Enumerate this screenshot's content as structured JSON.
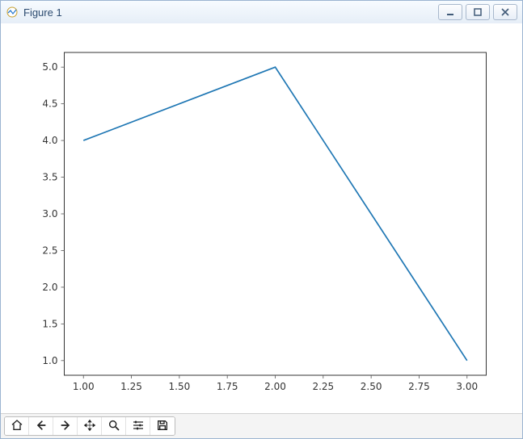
{
  "window": {
    "title": "Figure 1",
    "buttons": {
      "minimize": "minimize",
      "maximize": "maximize",
      "close": "close"
    }
  },
  "chart_data": {
    "type": "line",
    "x": [
      1,
      2,
      3
    ],
    "y": [
      4,
      5,
      1
    ],
    "x_ticks": [
      "1.00",
      "1.25",
      "1.50",
      "1.75",
      "2.00",
      "2.25",
      "2.50",
      "2.75",
      "3.00"
    ],
    "y_ticks": [
      "1.0",
      "1.5",
      "2.0",
      "2.5",
      "3.0",
      "3.5",
      "4.0",
      "4.5",
      "5.0"
    ],
    "xlim": [
      1.0,
      3.0
    ],
    "ylim": [
      1.0,
      5.0
    ],
    "xlabel": "",
    "ylabel": "",
    "title": ""
  },
  "toolbar": {
    "items": [
      {
        "name": "home",
        "label": "Home"
      },
      {
        "name": "back",
        "label": "Back"
      },
      {
        "name": "forward",
        "label": "Forward"
      },
      {
        "name": "pan",
        "label": "Pan"
      },
      {
        "name": "zoom",
        "label": "Zoom"
      },
      {
        "name": "configure",
        "label": "Configure subplots"
      },
      {
        "name": "save",
        "label": "Save figure"
      }
    ]
  }
}
